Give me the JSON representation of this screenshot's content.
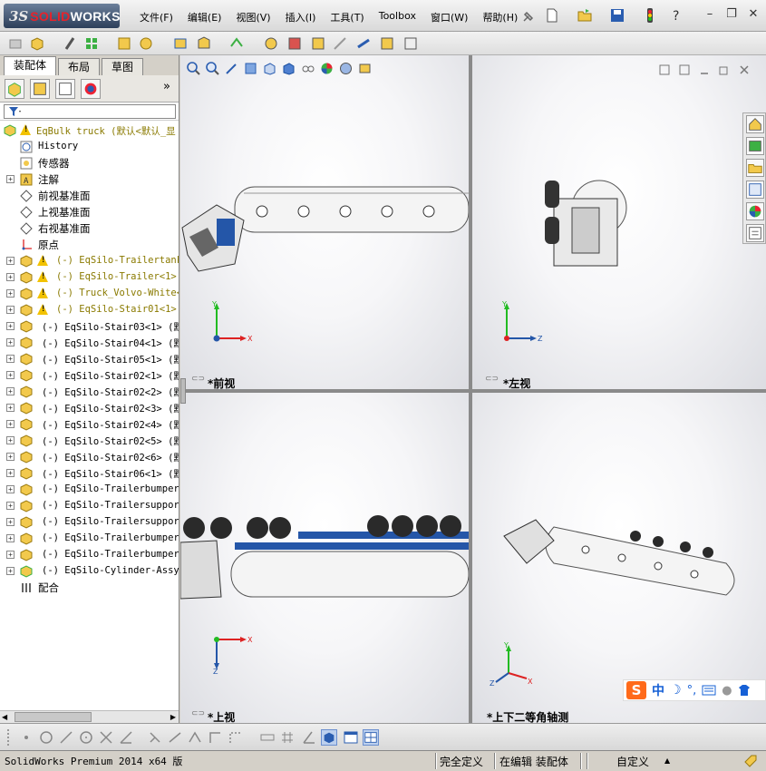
{
  "app": {
    "logo_prefix": "3S",
    "logo_name_a": "SOLID",
    "logo_name_b": "WORKS"
  },
  "menu": [
    "文件(F)",
    "编辑(E)",
    "视图(V)",
    "插入(I)",
    "工具(T)",
    "Toolbox",
    "窗口(W)",
    "帮助(H)"
  ],
  "tabs": [
    "装配体",
    "布局",
    "草图"
  ],
  "tree": {
    "root": "EqBulk truck  (默认<默认_显",
    "items": [
      {
        "label": "History",
        "type": "history"
      },
      {
        "label": "传感器",
        "type": "sensor"
      },
      {
        "label": "注解",
        "type": "annotation",
        "exp": true
      },
      {
        "label": "前视基准面",
        "type": "plane"
      },
      {
        "label": "上视基准面",
        "type": "plane"
      },
      {
        "label": "右视基准面",
        "type": "plane"
      },
      {
        "label": "原点",
        "type": "origin"
      },
      {
        "label": "(-) EqSilo-Trailertank<",
        "type": "warn",
        "exp": true
      },
      {
        "label": "(-) EqSilo-Trailer<1>",
        "type": "warn",
        "exp": true
      },
      {
        "label": "(-) Truck_Volvo-White<1",
        "type": "warn",
        "exp": true
      },
      {
        "label": "(-) EqSilo-Stair01<1>",
        "type": "warn",
        "exp": true
      },
      {
        "label": "(-) EqSilo-Stair03<1> (默",
        "type": "part",
        "exp": true
      },
      {
        "label": "(-) EqSilo-Stair04<1> (默",
        "type": "part",
        "exp": true
      },
      {
        "label": "(-) EqSilo-Stair05<1> (默",
        "type": "part",
        "exp": true
      },
      {
        "label": "(-) EqSilo-Stair02<1> (默",
        "type": "part",
        "exp": true
      },
      {
        "label": "(-) EqSilo-Stair02<2> (默",
        "type": "part",
        "exp": true
      },
      {
        "label": "(-) EqSilo-Stair02<3> (默",
        "type": "part",
        "exp": true
      },
      {
        "label": "(-) EqSilo-Stair02<4> (默",
        "type": "part",
        "exp": true
      },
      {
        "label": "(-) EqSilo-Stair02<5> (默",
        "type": "part",
        "exp": true
      },
      {
        "label": "(-) EqSilo-Stair02<6> (默",
        "type": "part",
        "exp": true
      },
      {
        "label": "(-) EqSilo-Stair06<1> (默",
        "type": "part",
        "exp": true
      },
      {
        "label": "(-) EqSilo-Trailerbumper<",
        "type": "part",
        "exp": true
      },
      {
        "label": "(-) EqSilo-Trailersupport",
        "type": "part",
        "exp": true
      },
      {
        "label": "(-) EqSilo-Trailersupport",
        "type": "part",
        "exp": true
      },
      {
        "label": "(-) EqSilo-Trailerbumper-",
        "type": "part",
        "exp": true
      },
      {
        "label": "(-) EqSilo-Trailerbumper-",
        "type": "part",
        "exp": true
      },
      {
        "label": "(-) EqSilo-Cylinder-Assy<",
        "type": "assy",
        "exp": true
      },
      {
        "label": "配合",
        "type": "mates"
      }
    ]
  },
  "viewports": {
    "front": {
      "label": "*前视",
      "axes": [
        "Y",
        "X"
      ]
    },
    "left": {
      "label": "*左视",
      "axes": [
        "Y",
        "Z"
      ]
    },
    "top": {
      "label": "*上视",
      "axes": [
        "X",
        "Z"
      ]
    },
    "iso": {
      "label": "*上下二等角轴测",
      "axes": [
        "Y",
        "X",
        "Z"
      ]
    }
  },
  "status": {
    "product": "SolidWorks Premium 2014 x64 版",
    "state": "完全定义",
    "mode": "在编辑 装配体",
    "units": "自定义"
  },
  "ime": {
    "logo": "S",
    "lang": "中"
  },
  "colors": {
    "accent": "#1a4fa0",
    "warning": "#f2c200",
    "tank": "#f4f4f4",
    "frame": "#2456a8"
  }
}
